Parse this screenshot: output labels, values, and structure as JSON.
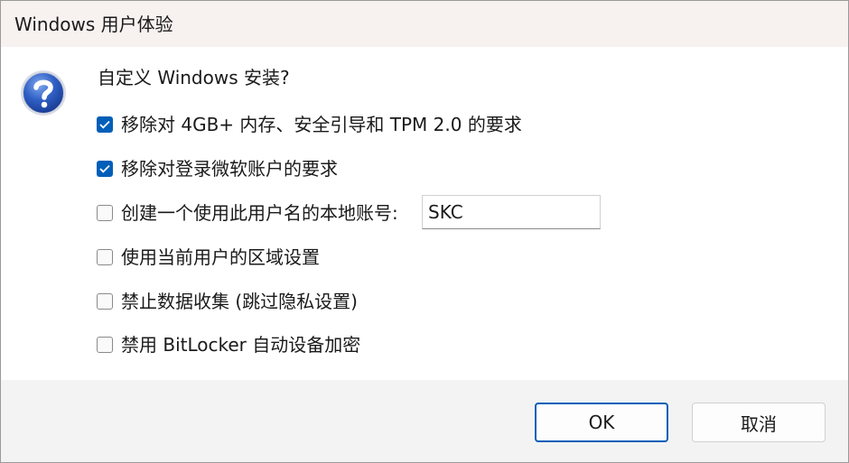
{
  "window": {
    "title": "Windows 用户体验"
  },
  "prompt": "自定义 Windows 安装?",
  "options": [
    {
      "label": "移除对 4GB+ 内存、安全引导和 TPM 2.0 的要求",
      "checked": true
    },
    {
      "label": "移除对登录微软账户的要求",
      "checked": true
    },
    {
      "label": "创建一个使用此用户名的本地账号:",
      "checked": false
    },
    {
      "label": "使用当前用户的区域设置",
      "checked": false
    },
    {
      "label": "禁止数据收集 (跳过隐私设置)",
      "checked": false
    },
    {
      "label": "禁用 BitLocker 自动设备加密",
      "checked": false
    }
  ],
  "username": {
    "value": "SKC"
  },
  "buttons": {
    "ok": "OK",
    "cancel": "取消"
  },
  "colors": {
    "accent": "#005fb8",
    "titlebar": "#f7f1f0",
    "footer": "#f3f3f3"
  },
  "icons": {
    "dialog": "question-icon"
  }
}
